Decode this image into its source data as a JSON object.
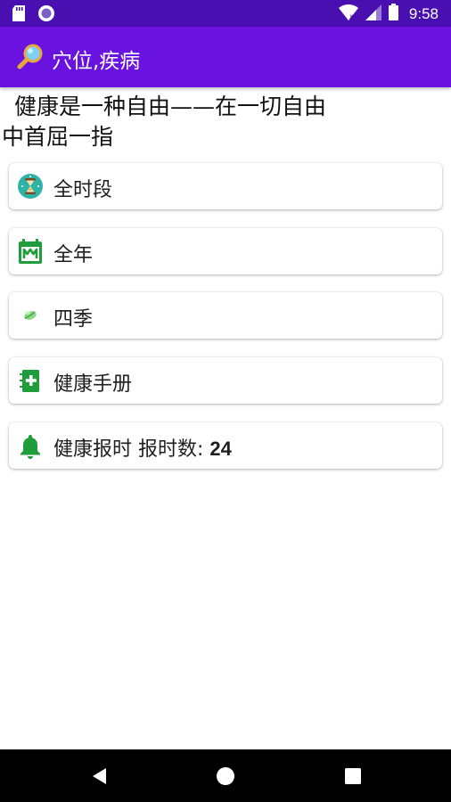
{
  "status_bar": {
    "time": "9:58",
    "icons": [
      "sd-card-icon",
      "circle-notification-icon",
      "wifi-icon",
      "cell-signal-icon",
      "battery-icon"
    ]
  },
  "app_bar": {
    "title": "穴位,疾病",
    "icon": "magnifier-icon",
    "color": "#6a13e0"
  },
  "motto": {
    "line1": "健康是一种自由——在一切自由",
    "line2": "中首屈一指"
  },
  "menu": {
    "items": [
      {
        "label": "全时段",
        "icon": "hourglass-icon"
      },
      {
        "label": "全年",
        "icon": "calendar-icon"
      },
      {
        "label": "四季",
        "icon": "leaf-icon"
      },
      {
        "label": "健康手册",
        "icon": "health-book-icon"
      },
      {
        "label": "健康报时 报时数: ",
        "count": "24",
        "icon": "bell-icon"
      }
    ]
  },
  "nav_bar": {
    "buttons": [
      "back-icon",
      "home-icon",
      "recents-icon"
    ]
  },
  "colors": {
    "status_bar": "#4a0fb0",
    "app_bar": "#6a13e0",
    "icon_green": "#1f9d3a"
  }
}
